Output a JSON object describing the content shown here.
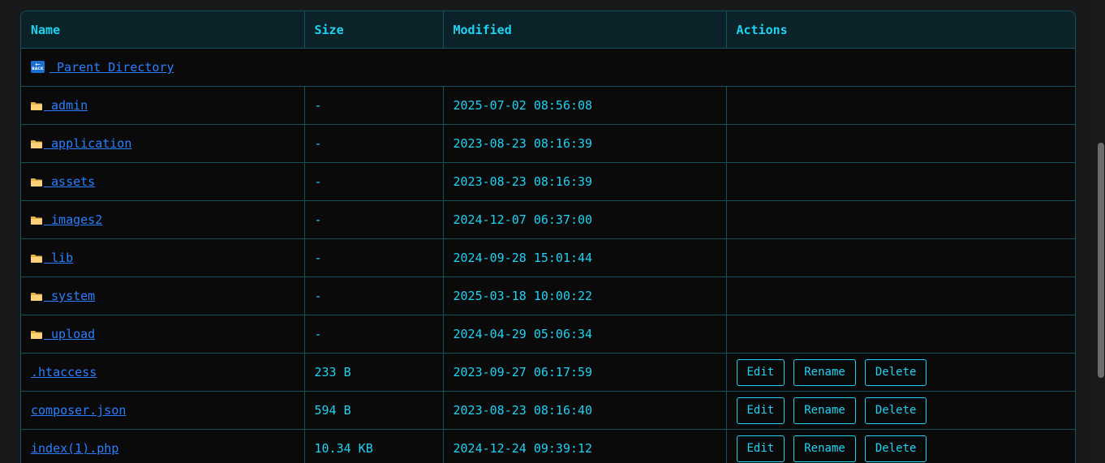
{
  "table": {
    "headers": {
      "name": "Name",
      "size": "Size",
      "modified": "Modified",
      "actions": "Actions"
    },
    "parent_label": "Parent Directory",
    "folders": [
      {
        "name": "admin",
        "size": "-",
        "modified": "2025-07-02 08:56:08"
      },
      {
        "name": "application",
        "size": "-",
        "modified": "2023-08-23 08:16:39"
      },
      {
        "name": "assets",
        "size": "-",
        "modified": "2023-08-23 08:16:39"
      },
      {
        "name": "images2",
        "size": "-",
        "modified": "2024-12-07 06:37:00"
      },
      {
        "name": "lib",
        "size": "-",
        "modified": "2024-09-28 15:01:44"
      },
      {
        "name": "system",
        "size": "-",
        "modified": "2025-03-18 10:00:22"
      },
      {
        "name": "upload",
        "size": "-",
        "modified": "2024-04-29 05:06:34"
      }
    ],
    "files": [
      {
        "name": ".htaccess",
        "size": "233 B",
        "modified": "2023-09-27 06:17:59"
      },
      {
        "name": "composer.json",
        "size": "594 B",
        "modified": "2023-08-23 08:16:40"
      },
      {
        "name": "index(1).php",
        "size": "10.34 KB",
        "modified": "2024-12-24 09:39:12"
      }
    ],
    "action_labels": {
      "edit": "Edit",
      "rename": "Rename",
      "delete": "Delete"
    }
  },
  "colors": {
    "accent": "#1fd2f0",
    "link": "#2a7fff",
    "border": "#14515e",
    "header_bg": "#0a2228",
    "row_bg": "#0b0a0b",
    "page_bg": "#17191b"
  },
  "icons": {
    "folder": "folder-icon",
    "back": "back-icon"
  }
}
